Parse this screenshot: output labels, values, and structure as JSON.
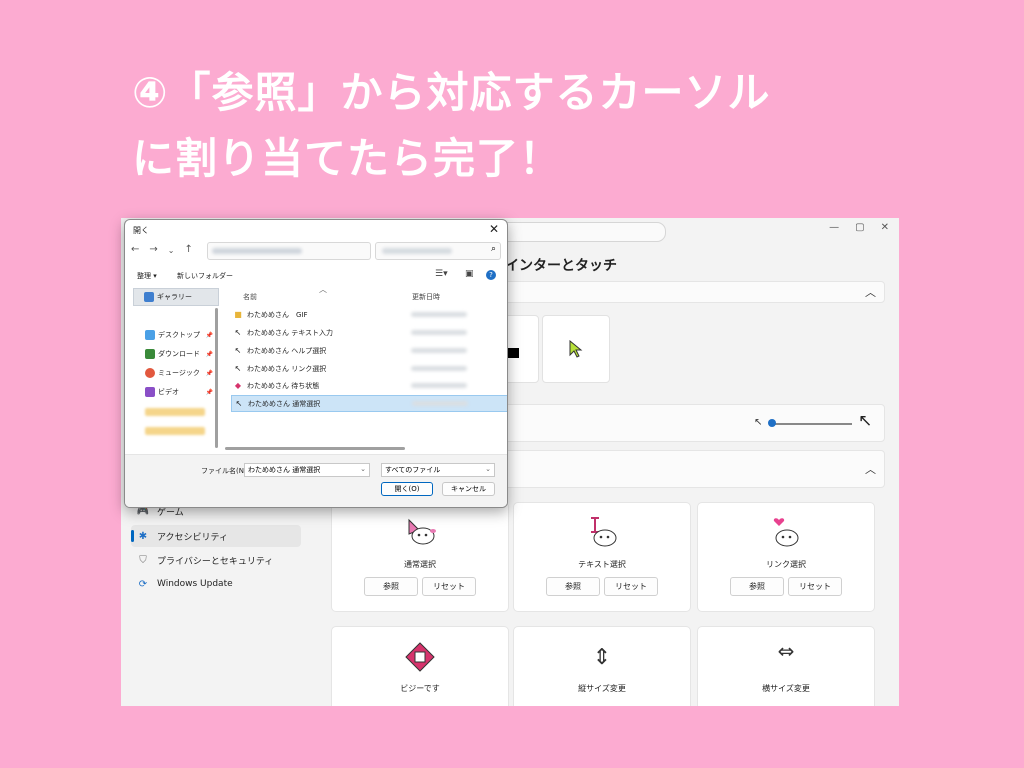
{
  "headline": {
    "line1": "④「参照」から対応するカーソル",
    "line2": "に割り当てたら完了！"
  },
  "settings": {
    "title": "インターとタッチ",
    "window_buttons": [
      "—",
      "▢",
      "✕"
    ],
    "nav": [
      {
        "label": "ゲーム",
        "icon": "gamepad-icon"
      },
      {
        "label": "アクセシビリティ",
        "icon": "accessibility-icon",
        "selected": true
      },
      {
        "label": "プライバシーとセキュリティ",
        "icon": "shield-icon"
      },
      {
        "label": "Windows Update",
        "icon": "windows-update-icon"
      }
    ],
    "cursor_cards": [
      {
        "label": "通常選択",
        "glyph": "↖"
      },
      {
        "label": "テキスト選択",
        "glyph": "I"
      },
      {
        "label": "リンク選択",
        "glyph": "♥"
      },
      {
        "label": "ビジーです",
        "glyph": "◆"
      },
      {
        "label": "縦サイズ変更",
        "glyph": "⇕"
      },
      {
        "label": "横サイズ変更",
        "glyph": "⇔"
      }
    ],
    "browse_label": "参照",
    "reset_label": "リセット"
  },
  "dialog": {
    "title": "開く",
    "close": "✕",
    "organize": "整理 ▾",
    "new_folder": "新しいフォルダー",
    "sidebar": [
      {
        "label": "ギャラリー",
        "color": "#3f7fcf",
        "selected": true
      },
      {
        "label": "デスクトップ",
        "color": "#4aa0e6",
        "pin": true
      },
      {
        "label": "ダウンロード",
        "color": "#3a8a3a",
        "pin": true
      },
      {
        "label": "ミュージック",
        "color": "#e2583e",
        "pin": true
      },
      {
        "label": "ビデオ",
        "color": "#8a4fc7",
        "pin": true
      }
    ],
    "columns": {
      "name": "名前",
      "date": "更新日時"
    },
    "files": [
      {
        "name": "わためめさん　GIF",
        "icon": "folder-icon"
      },
      {
        "name": "わためめさん テキスト入力",
        "icon": "cursor-file-icon"
      },
      {
        "name": "わためめさん ヘルプ選択",
        "icon": "cursor-file-icon"
      },
      {
        "name": "わためめさん リンク選択",
        "icon": "cursor-file-icon"
      },
      {
        "name": "わためめさん 待ち状態",
        "icon": "busy-cursor-file-icon"
      },
      {
        "name": "わためめさん 通常選択",
        "icon": "cursor-file-icon",
        "selected": true
      }
    ],
    "filename_label": "ファイル名(N):",
    "filename_value": "わためめさん 通常選択",
    "filetype_value": "すべてのファイル",
    "open_button": "開く(O)",
    "cancel_button": "キャンセル"
  }
}
